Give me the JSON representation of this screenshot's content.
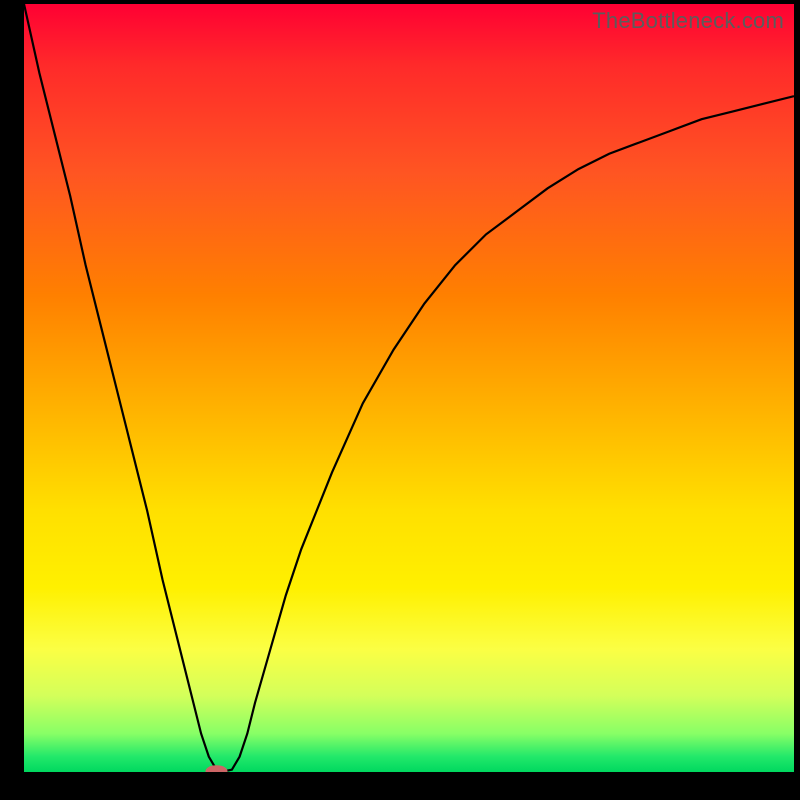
{
  "watermark": "TheBottleneck.com",
  "chart_data": {
    "type": "line",
    "title": "",
    "xlabel": "",
    "ylabel": "",
    "xlim": [
      0,
      100
    ],
    "ylim": [
      0,
      100
    ],
    "x": [
      0,
      2,
      4,
      6,
      8,
      10,
      12,
      14,
      16,
      18,
      20,
      22,
      23,
      24,
      25,
      26,
      27,
      28,
      29,
      30,
      32,
      34,
      36,
      38,
      40,
      44,
      48,
      52,
      56,
      60,
      64,
      68,
      72,
      76,
      80,
      84,
      88,
      92,
      96,
      100
    ],
    "values": [
      100,
      91,
      83,
      75,
      66,
      58,
      50,
      42,
      34,
      25,
      17,
      9,
      5,
      2,
      0.3,
      0.1,
      0.3,
      2,
      5,
      9,
      16,
      23,
      29,
      34,
      39,
      48,
      55,
      61,
      66,
      70,
      73,
      76,
      78.5,
      80.5,
      82,
      83.5,
      85,
      86,
      87,
      88
    ],
    "minimum_x": 25,
    "gradient_stops": [
      {
        "pos": 0.0,
        "color": "#ff0033"
      },
      {
        "pos": 0.22,
        "color": "#ff5522"
      },
      {
        "pos": 0.52,
        "color": "#ffb000"
      },
      {
        "pos": 0.76,
        "color": "#fff000"
      },
      {
        "pos": 0.95,
        "color": "#88ff66"
      },
      {
        "pos": 1.0,
        "color": "#00d85f"
      }
    ],
    "marker": {
      "x_pct": 25,
      "y_pct": 0.1,
      "color": "#cc6666"
    }
  }
}
